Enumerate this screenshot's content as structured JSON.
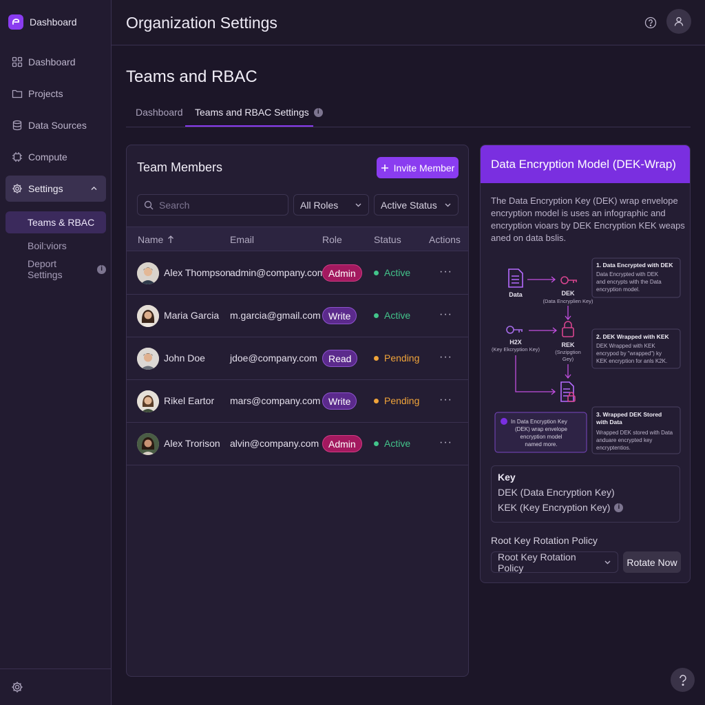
{
  "brand": {
    "label": "Dashboard"
  },
  "sidebar": {
    "items": [
      {
        "label": "Dashboard",
        "icon": "grid-icon"
      },
      {
        "label": "Projects",
        "icon": "folder-icon"
      },
      {
        "label": "Data Sources",
        "icon": "database-icon"
      },
      {
        "label": "Compute",
        "icon": "chip-icon"
      },
      {
        "label": "Settings",
        "icon": "gear-icon",
        "expanded": true
      }
    ],
    "sub_items": [
      {
        "label": "Teams & RBAC",
        "active": true
      },
      {
        "label": "Boil:viors"
      },
      {
        "label": "Deport Settings"
      }
    ]
  },
  "header": {
    "title": "Organization Settings"
  },
  "page": {
    "title": "Teams and RBAC"
  },
  "tabs": [
    {
      "label": "Dashboard"
    },
    {
      "label": "Teams and RBAC Settings",
      "active": true
    }
  ],
  "members_panel": {
    "title": "Team Members",
    "invite_label": "Invite Member",
    "search_placeholder": "Search",
    "roles_filter": "All Roles",
    "status_filter": "Active Status",
    "columns": [
      "Name",
      "Email",
      "Role",
      "Status",
      "Actions"
    ],
    "rows": [
      {
        "name": "Alex Thompson",
        "email": "admin@company.com",
        "role": "Admin",
        "status": "Active"
      },
      {
        "name": "Maria Garcia",
        "email": "m.garcia@gmail.com",
        "role": "Write",
        "status": "Active"
      },
      {
        "name": "John Doe",
        "email": "jdoe@company.com",
        "role": "Read",
        "status": "Pending"
      },
      {
        "name": "Rikel Eartor",
        "email": "mars@company.com",
        "role": "Write",
        "status": "Pending"
      },
      {
        "name": "Alex Trorison",
        "email": "alvin@company.com",
        "role": "Admin",
        "status": "Active"
      }
    ],
    "actions_glyph": "···"
  },
  "dek_panel": {
    "title": "Data Encryption Model (DEK-Wrap)",
    "description": "The Data Encryption Key (DEK) wrap envelope encryption model is uses an infographic and encryption vioars by DEK Encryption KEK weaps aned on data bslis.",
    "diagram": {
      "data_label": "Data",
      "dek_label": "DEK",
      "dek_sub": "(Data Encryplien Key)",
      "kek_label": "H2X",
      "kek_sub": "(Key Ekcryption Key)",
      "rek_label": "REK",
      "rek_sub_1": "(Snzipgtion",
      "rek_sub_2": "Gey)",
      "step1_title": "1. Data Encrypted with DEK",
      "step1_lines": [
        "Data Encrypted with DEK",
        "and encrypts with the Data",
        "encryption model."
      ],
      "step2_title": "2. DEK Wrapped with KEK",
      "step2_lines": [
        "DEK Wrapped with KEK",
        "encrypod by \"wrapped\") ky",
        "KEK encryption for anls K2K."
      ],
      "step3_title_1": "3. Wrapped DEK Stored",
      "step3_title_2": "with Data",
      "step3_lines": [
        "Wrapped DEK stored with Data",
        "anduare encrypted key",
        "encryptentios."
      ],
      "note_lines": [
        "In Data Encryption Key",
        "(DEK) wrap envelope",
        "encryption model",
        "named more."
      ]
    },
    "key_title": "Key",
    "key_dek": "DEK (Data Encryption Key)",
    "key_kek": "KEK (Key Encryption Key)",
    "rotation_label": "Root Key Rotation Policy",
    "rotation_select": "Root Key Rotation Policy",
    "rotate_button": "Rotate Now"
  },
  "colors": {
    "accent": "#8a3cf0",
    "active": "#43c48b",
    "pending": "#f0a43a",
    "admin": "#a3195f"
  }
}
